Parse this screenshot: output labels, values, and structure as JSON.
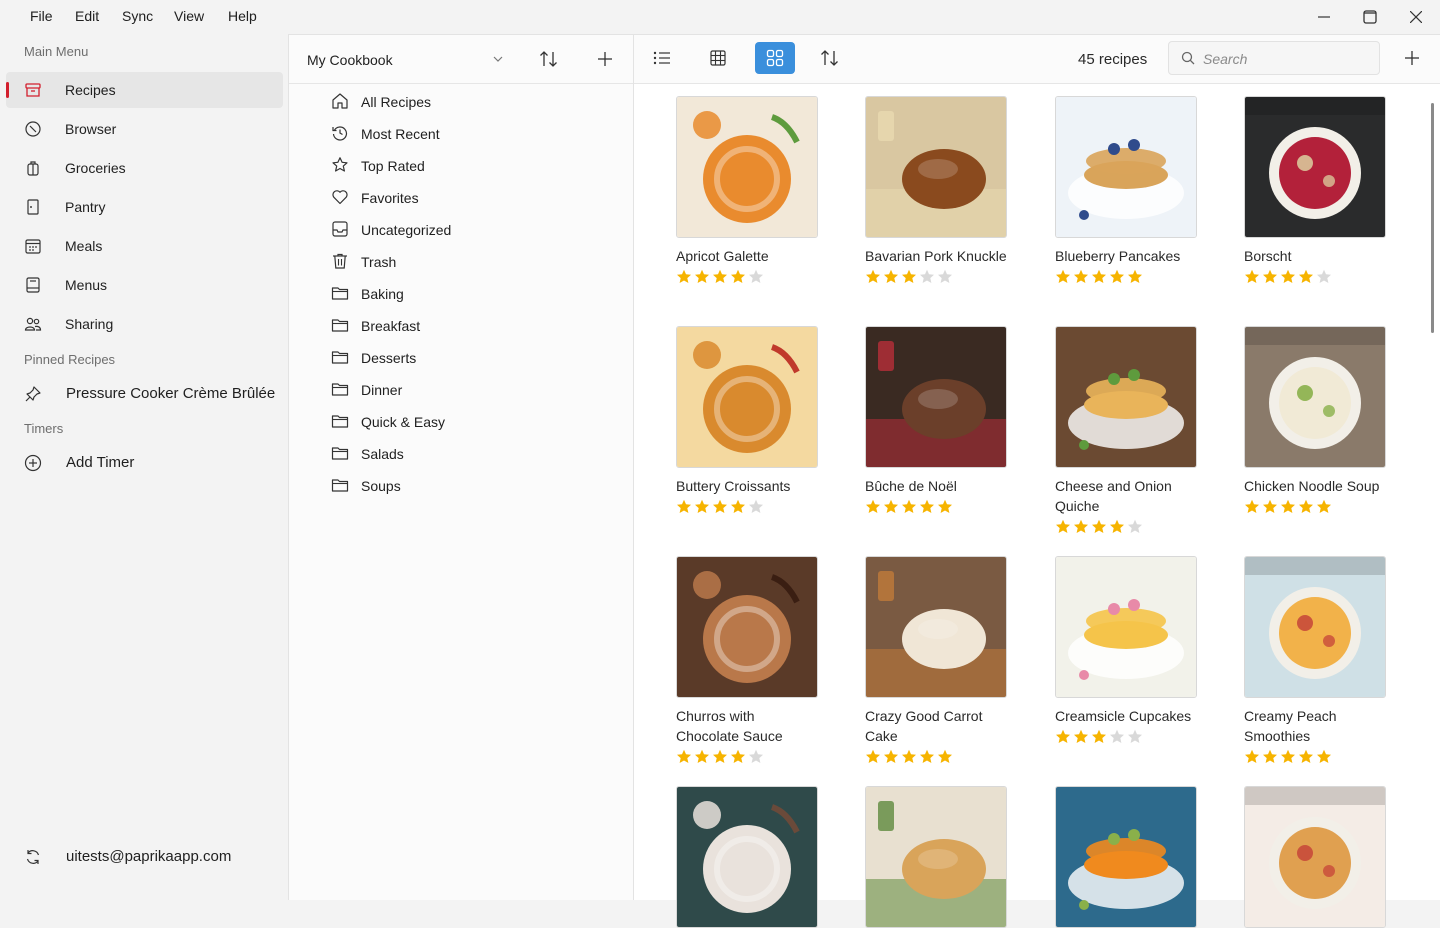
{
  "menubar": {
    "items": [
      "File",
      "Edit",
      "Sync",
      "View",
      "Help"
    ]
  },
  "sidebar": {
    "main_menu_label": "Main Menu",
    "items": [
      {
        "label": "Recipes",
        "icon": "recipes-box-icon"
      },
      {
        "label": "Browser",
        "icon": "compass-icon"
      },
      {
        "label": "Groceries",
        "icon": "grocery-bag-icon"
      },
      {
        "label": "Pantry",
        "icon": "pantry-door-icon"
      },
      {
        "label": "Meals",
        "icon": "calendar-icon"
      },
      {
        "label": "Menus",
        "icon": "menu-book-icon"
      },
      {
        "label": "Sharing",
        "icon": "people-icon"
      }
    ],
    "active_item": "Recipes",
    "pinned_label": "Pinned Recipes",
    "pinned": [
      "Pressure Cooker Crème Brûlée"
    ],
    "timers_label": "Timers",
    "add_timer": "Add Timer",
    "account_email": "uitests@paprikaapp.com"
  },
  "cookbook": {
    "selected": "My Cookbook",
    "categories": [
      {
        "label": "All Recipes",
        "icon": "home-icon"
      },
      {
        "label": "Most Recent",
        "icon": "history-icon"
      },
      {
        "label": "Top Rated",
        "icon": "star-outline-icon"
      },
      {
        "label": "Favorites",
        "icon": "heart-icon"
      },
      {
        "label": "Uncategorized",
        "icon": "inbox-icon"
      },
      {
        "label": "Trash",
        "icon": "trash-icon"
      },
      {
        "label": "Baking",
        "icon": "folder-icon"
      },
      {
        "label": "Breakfast",
        "icon": "folder-icon"
      },
      {
        "label": "Desserts",
        "icon": "folder-icon"
      },
      {
        "label": "Dinner",
        "icon": "folder-icon"
      },
      {
        "label": "Quick & Easy",
        "icon": "folder-icon"
      },
      {
        "label": "Salads",
        "icon": "folder-icon"
      },
      {
        "label": "Soups",
        "icon": "folder-icon"
      }
    ]
  },
  "toolbar": {
    "recipe_count": "45 recipes",
    "active_view": "grid",
    "search_placeholder": "Search"
  },
  "colors": {
    "accent_blue": "#3a8fdc",
    "accent_red": "#d21f2d",
    "star_filled": "#f6b400",
    "star_empty": "#d9d9d9"
  },
  "recipes": [
    {
      "title": "Apricot Galette",
      "rating": 4,
      "palette": [
        "#f2e8d8",
        "#e98b2e",
        "#5e9b3d"
      ]
    },
    {
      "title": "Bavarian Pork Knuckle",
      "rating": 3,
      "palette": [
        "#d9c7a1",
        "#8a4a1e",
        "#e8d9b0"
      ]
    },
    {
      "title": "Blueberry Pancakes",
      "rating": 5,
      "palette": [
        "#eef3f8",
        "#d9a45a",
        "#2f4b8c"
      ]
    },
    {
      "title": "Borscht",
      "rating": 4,
      "palette": [
        "#2a2b2c",
        "#b3213a",
        "#d9c59a"
      ]
    },
    {
      "title": "Buttery Croissants",
      "rating": 4,
      "palette": [
        "#f4d9a0",
        "#d98a2e",
        "#c0392b"
      ]
    },
    {
      "title": "Bûche de Noël",
      "rating": 5,
      "palette": [
        "#3a2a22",
        "#6b3f2a",
        "#b82e3a"
      ]
    },
    {
      "title": "Cheese and Onion Quiche",
      "rating": 4,
      "palette": [
        "#6b4a32",
        "#e9b45a",
        "#5e9b3d"
      ]
    },
    {
      "title": "Chicken Noodle Soup",
      "rating": 5,
      "palette": [
        "#8a7a6a",
        "#f1ead6",
        "#8ab04a"
      ]
    },
    {
      "title": "Churros with Chocolate Sauce",
      "rating": 4,
      "palette": [
        "#5a3a28",
        "#b9784a",
        "#3a1e12"
      ]
    },
    {
      "title": "Crazy Good Carrot Cake",
      "rating": 5,
      "palette": [
        "#7a5a42",
        "#f0e6d6",
        "#c07a3a"
      ]
    },
    {
      "title": "Creamsicle Cupcakes",
      "rating": 3,
      "palette": [
        "#f2f2ea",
        "#f5c44a",
        "#e88aa8"
      ]
    },
    {
      "title": "Creamy Peach Smoothies",
      "rating": 5,
      "palette": [
        "#cfe0e6",
        "#f2b24a",
        "#c84a3a"
      ]
    },
    {
      "title": "",
      "rating": 0,
      "palette": [
        "#2f4a4a",
        "#e9e2dc",
        "#6a4a3a"
      ]
    },
    {
      "title": "",
      "rating": 0,
      "palette": [
        "#e8e0d0",
        "#d9a45a",
        "#5e8a3d"
      ]
    },
    {
      "title": "",
      "rating": 0,
      "palette": [
        "#2d6a8c",
        "#f08a1e",
        "#8ab04a"
      ]
    },
    {
      "title": "",
      "rating": 0,
      "palette": [
        "#f4ece6",
        "#e0a050",
        "#c84a3a"
      ]
    }
  ]
}
